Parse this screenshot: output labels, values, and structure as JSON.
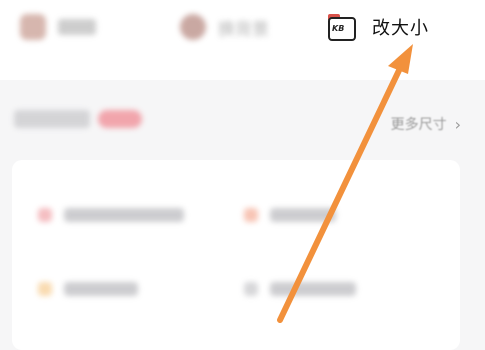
{
  "tools": [
    {
      "label": "",
      "icon": "image-icon",
      "state": "blurred"
    },
    {
      "label": "换背景",
      "icon": "portrait-icon",
      "state": "blurred"
    },
    {
      "label": "改大小",
      "icon": "kb-resize-icon",
      "icon_text": "KB",
      "state": "sharp"
    }
  ],
  "section": {
    "title": "",
    "more_label": "更多尺寸"
  },
  "items": [
    {
      "label": "",
      "color": "#f1a8ad"
    },
    {
      "label": "",
      "color": "#f5b19c"
    },
    {
      "label": "",
      "color": "#f7cf97"
    },
    {
      "label": "",
      "color": "#c9c9cc"
    }
  ],
  "annotation": {
    "type": "arrow",
    "color": "#f2913c"
  }
}
